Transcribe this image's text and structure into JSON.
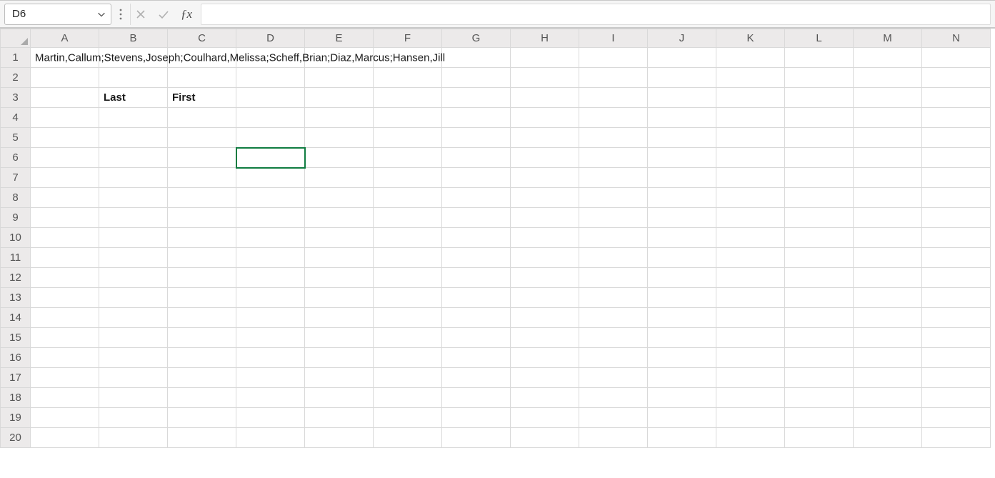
{
  "formula_bar": {
    "name_box_value": "D6",
    "formula_value": ""
  },
  "columns": [
    "A",
    "B",
    "C",
    "D",
    "E",
    "F",
    "G",
    "H",
    "I",
    "J",
    "K",
    "L",
    "M",
    "N"
  ],
  "row_count": 20,
  "active_cell": {
    "row": 6,
    "col": "D"
  },
  "cells": {
    "A1": {
      "value": "Martin,Callum;Stevens,Joseph;Coulhard,Melissa;Scheff,Brian;Diaz,Marcus;Hansen,Jill",
      "overflow": true
    },
    "B3": {
      "value": "Last",
      "bold": true
    },
    "C3": {
      "value": "First",
      "bold": true
    }
  }
}
